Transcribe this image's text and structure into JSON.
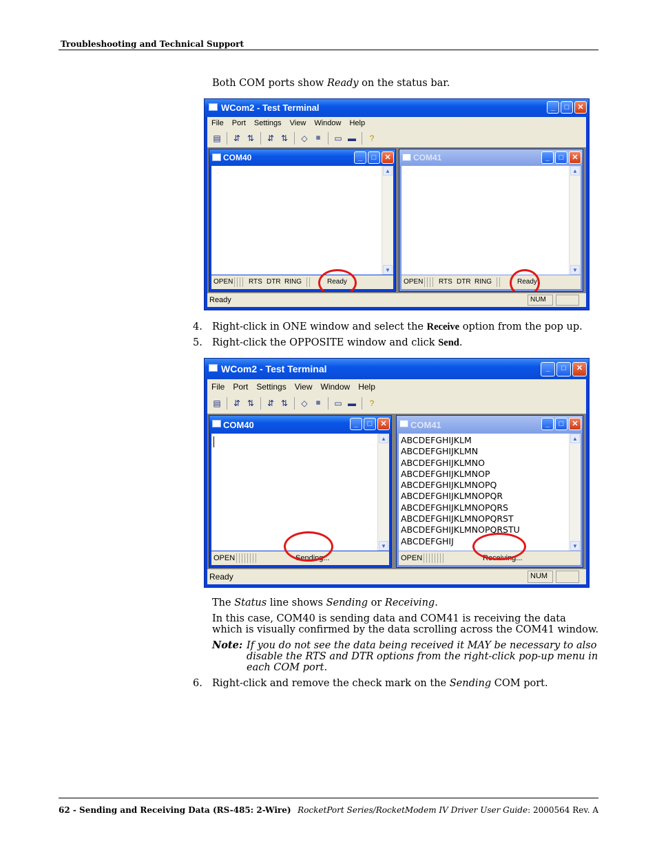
{
  "header": {
    "section_title": "Troubleshooting and Technical Support"
  },
  "intro": {
    "before": "Both COM ports show ",
    "italic": "Ready",
    "after": " on the status bar."
  },
  "screenshot1": {
    "window_title": "WCom2 - Test Terminal",
    "menu": [
      "File",
      "Port",
      "Settings",
      "View",
      "Window",
      "Help"
    ],
    "status": "Ready",
    "num": "NUM",
    "com40": {
      "title": "COM40",
      "open": "OPEN",
      "rts": "RTS",
      "dtr": "DTR",
      "ring": "RING",
      "state": "Ready"
    },
    "com41": {
      "title": "COM41",
      "open": "OPEN",
      "rts": "RTS",
      "dtr": "DTR",
      "ring": "RING",
      "state": "Ready"
    }
  },
  "steps": [
    {
      "num": "4.",
      "before": "Right-click in ONE window and select the ",
      "bold": "Receive",
      "after": " option from the pop up."
    },
    {
      "num": "5.",
      "before": "Right-click the OPPOSITE window and click ",
      "bold": "Send",
      "after": "."
    }
  ],
  "screenshot2": {
    "window_title": "WCom2 - Test Terminal",
    "menu": [
      "File",
      "Port",
      "Settings",
      "View",
      "Window",
      "Help"
    ],
    "status": "Ready",
    "num": "NUM",
    "com40": {
      "title": "COM40",
      "open": "OPEN",
      "state": "Sending..."
    },
    "com41": {
      "title": "COM41",
      "open": "OPEN",
      "state": "Receiving...",
      "lines": [
        "ABCDEFGHIJKLM",
        "ABCDEFGHIJKLMN",
        "ABCDEFGHIJKLMNO",
        "ABCDEFGHIJKLMNOP",
        "ABCDEFGHIJKLMNOPQ",
        "ABCDEFGHIJKLMNOPQR",
        "ABCDEFGHIJKLMNOPQRS",
        "ABCDEFGHIJKLMNOPQRST",
        "ABCDEFGHIJKLMNOPQRSTU",
        "ABCDEFGHIJ"
      ]
    }
  },
  "status_para": {
    "p1": "The ",
    "i1": "Status",
    "p2": " line shows ",
    "i2": "Sending",
    "p3": " or ",
    "i3": "Receiving",
    "p4": "."
  },
  "case_para": "In this case, COM40 is sending data and COM41 is receiving the data which is visually confirmed by the data scrolling across the COM41 window.",
  "note": {
    "label": "Note:",
    "text": "If you do not see the data being received it MAY be necessary to also disable the RTS and DTR options from the right-click pop-up menu in each COM port."
  },
  "step6": {
    "num": "6.",
    "before": "Right-click and remove the check mark on the ",
    "italic": "Sending",
    "after": " COM port."
  },
  "footer": {
    "left": "62 - Sending and Receiving Data (RS-485: 2-Wire)",
    "right_italic": "RocketPort Series/RocketModem IV Driver User Guide",
    "right_plain": ": 2000564 Rev. A"
  }
}
